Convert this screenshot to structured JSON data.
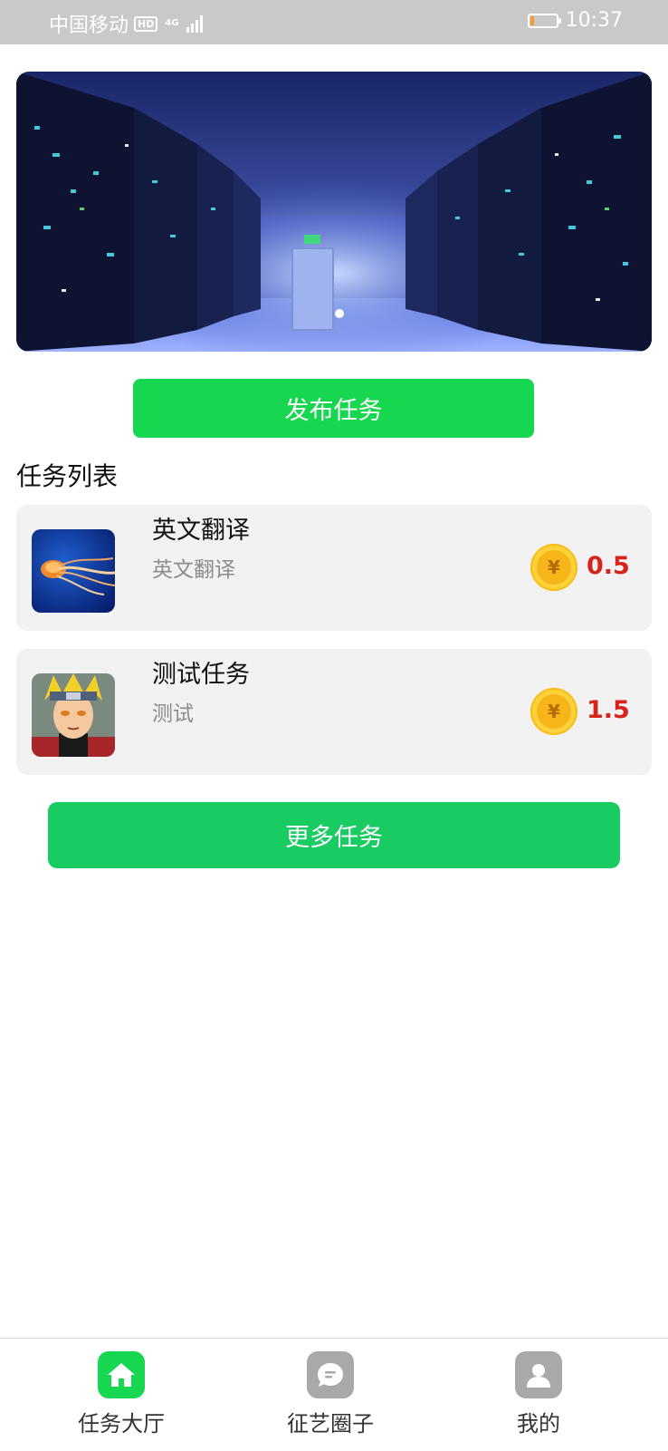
{
  "status_bar": {
    "carrier": "中国移动",
    "hd_badge": "HD",
    "network": "4G",
    "time": "10:37",
    "battery_level": 0.15
  },
  "banner": {
    "slide_count": 1,
    "active_slide": 1
  },
  "actions": {
    "publish_label": "发布任务",
    "more_label": "更多任务"
  },
  "section": {
    "title": "任务列表"
  },
  "tasks": [
    {
      "title": "英文翻译",
      "description": "英文翻译",
      "reward": "0.5",
      "coin_symbol": "¥",
      "thumbnail": "jellyfish-image"
    },
    {
      "title": "测试任务",
      "description": "测试",
      "reward": "1.5",
      "coin_symbol": "¥",
      "thumbnail": "anime-character-image"
    }
  ],
  "tab_bar": {
    "items": [
      {
        "label": "任务大厅",
        "icon": "home-icon",
        "active": true
      },
      {
        "label": "征艺圈子",
        "icon": "chat-icon",
        "active": false
      },
      {
        "label": "我的",
        "icon": "user-icon",
        "active": false
      }
    ]
  },
  "colors": {
    "primary_green": "#17d650",
    "more_button_green": "#19cc62",
    "reward_red": "#d6231c",
    "coin_gold": "#fcd13a",
    "status_bar_gray": "#c9c9c9"
  }
}
